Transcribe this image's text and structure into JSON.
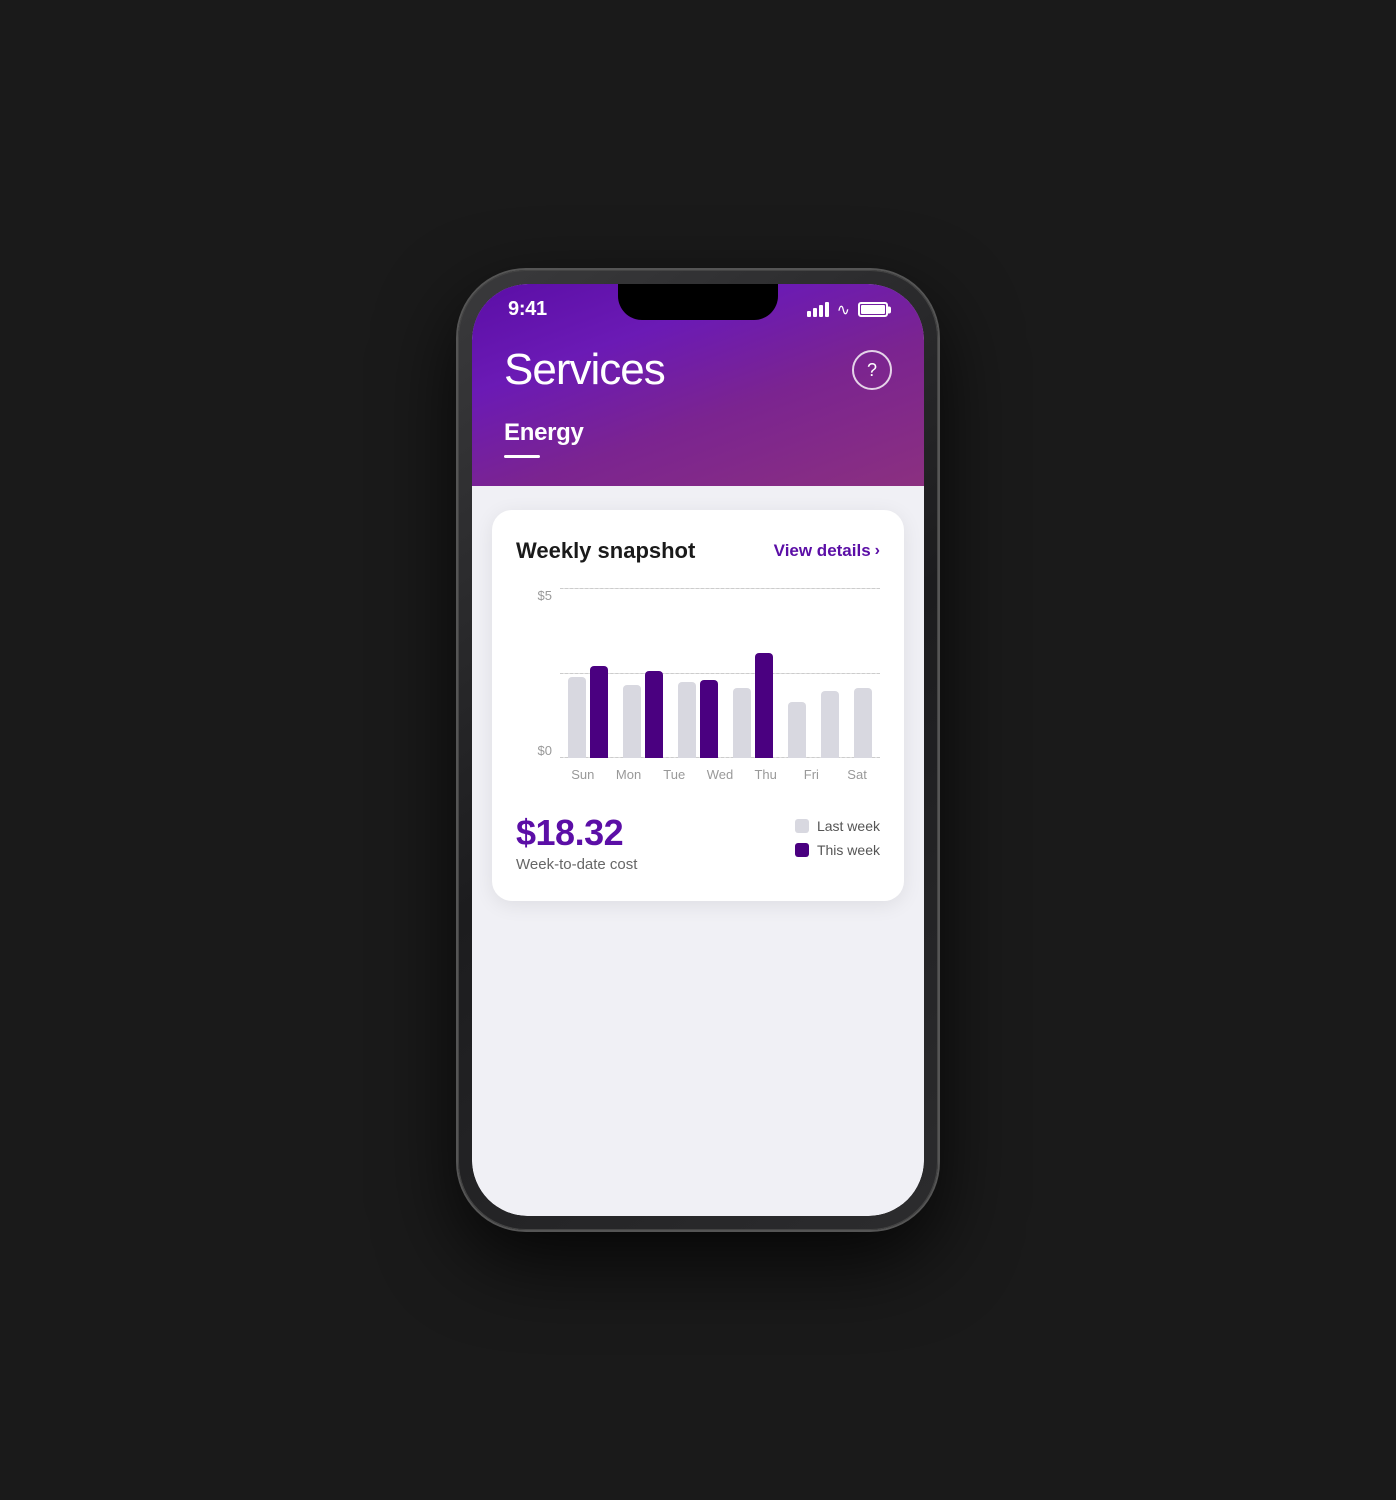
{
  "status_bar": {
    "time": "9:41"
  },
  "header": {
    "title": "Services",
    "subtitle": "Energy",
    "help_label": "?"
  },
  "card": {
    "title": "Weekly snapshot",
    "view_details_label": "View details",
    "chart": {
      "y_labels": [
        "$5",
        "$0"
      ],
      "y_top": "$5",
      "y_bottom": "$0",
      "days": [
        {
          "label": "Sun",
          "last_week_height_pct": 58,
          "this_week_height_pct": 66
        },
        {
          "label": "Mon",
          "last_week_height_pct": 52,
          "this_week_height_pct": 62
        },
        {
          "label": "Tue",
          "last_week_height_pct": 54,
          "this_week_height_pct": 56
        },
        {
          "label": "Wed",
          "last_week_height_pct": 50,
          "this_week_height_pct": 75
        },
        {
          "label": "Thu",
          "last_week_height_pct": 40,
          "this_week_height_pct": 0
        },
        {
          "label": "Fri",
          "last_week_height_pct": 48,
          "this_week_height_pct": 0
        },
        {
          "label": "Sat",
          "last_week_height_pct": 50,
          "this_week_height_pct": 0
        }
      ]
    },
    "cost_amount": "$18.32",
    "cost_label": "Week-to-date cost",
    "legend": {
      "last_week_label": "Last week",
      "this_week_label": "This week"
    }
  }
}
